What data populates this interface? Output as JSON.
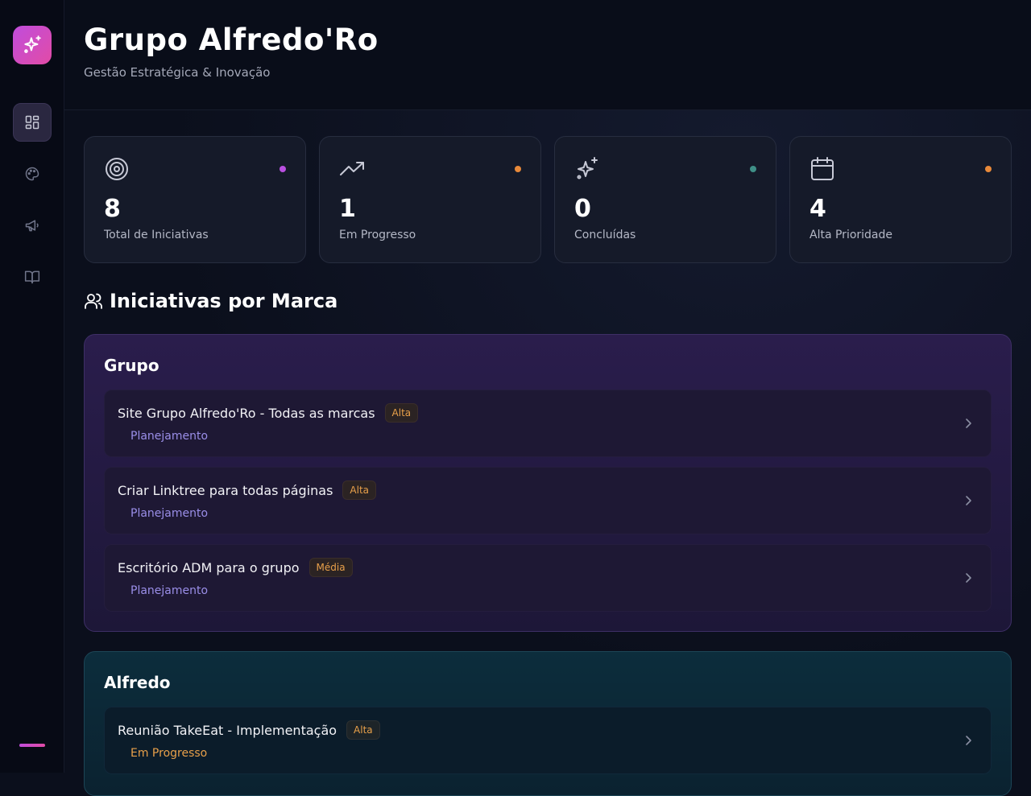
{
  "app": {
    "title": "Grupo Alfredo'Ro",
    "subtitle": "Gestão Estratégica & Inovação"
  },
  "sidebar": {
    "logo_icon": "sparkles-icon",
    "items": [
      {
        "icon": "dashboard-icon",
        "active": true
      },
      {
        "icon": "palette-icon",
        "active": false
      },
      {
        "icon": "megaphone-icon",
        "active": false
      },
      {
        "icon": "book-open-icon",
        "active": false
      }
    ]
  },
  "stats": [
    {
      "icon": "target-icon",
      "value": "8",
      "label": "Total de Iniciativas",
      "dot_color": "#b94fe0"
    },
    {
      "icon": "trending-up-icon",
      "value": "1",
      "label": "Em Progresso",
      "dot_color": "#e8893a"
    },
    {
      "icon": "sparkles-icon",
      "value": "0",
      "label": "Concluídas",
      "dot_color": "#3f8f87"
    },
    {
      "icon": "calendar-icon",
      "value": "4",
      "label": "Alta Prioridade",
      "dot_color": "#e8893a"
    }
  ],
  "section": {
    "icon": "users-icon",
    "title": "Iniciativas por Marca"
  },
  "brands": [
    {
      "name": "Grupo",
      "items": [
        {
          "title": "Site Grupo Alfredo'Ro - Todas as marcas",
          "priority": "Alta",
          "status": "Planejamento"
        },
        {
          "title": "Criar Linktree para todas páginas",
          "priority": "Alta",
          "status": "Planejamento"
        },
        {
          "title": "Escritório ADM para o grupo",
          "priority": "Média",
          "status": "Planejamento"
        }
      ]
    },
    {
      "name": "Alfredo",
      "items": [
        {
          "title": "Reunião TakeEat - Implementação",
          "priority": "Alta",
          "status": "Em Progresso"
        }
      ]
    }
  ],
  "colors": {
    "accent": "#c04ddc",
    "priority": "#e8a04a",
    "status_planning": "#9a8ee8",
    "status_progress": "#e8a04a"
  }
}
